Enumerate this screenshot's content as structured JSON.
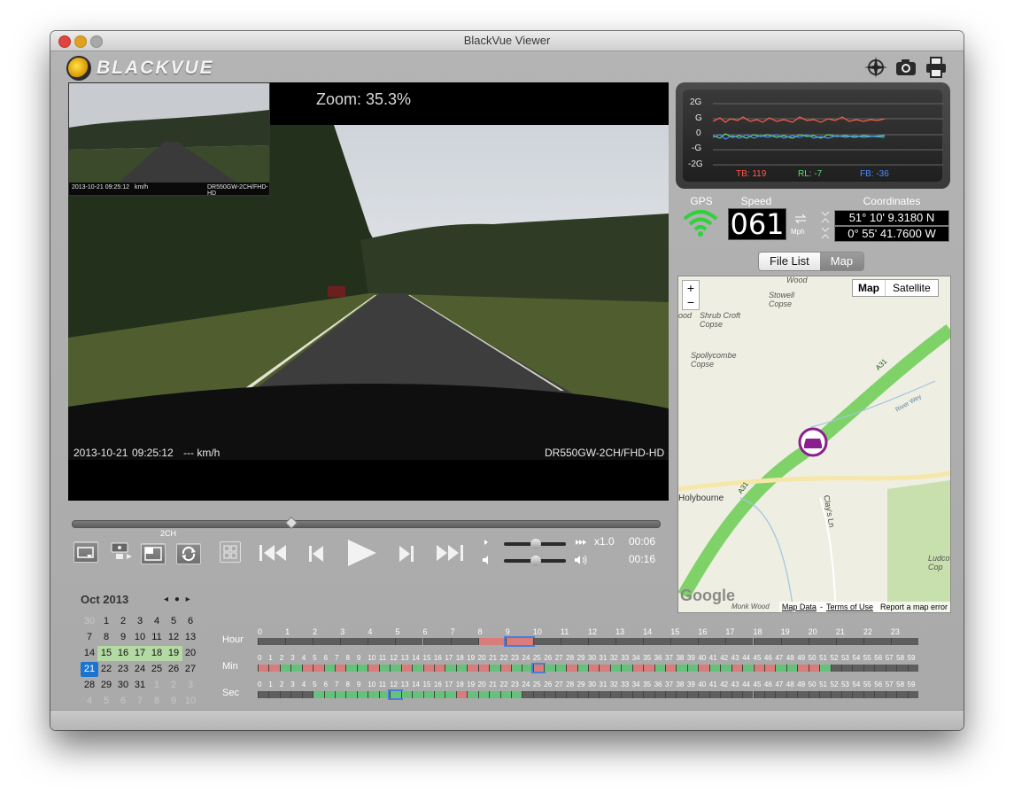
{
  "window": {
    "title": "BlackVue Viewer"
  },
  "brand": {
    "name": "BLACKVUE"
  },
  "video": {
    "zoom": "Zoom: 35.3%",
    "date": "2013-10-21",
    "time": "09:25:12",
    "speed": "--- km/h",
    "model": "DR550GW-2CH/FHD-HD",
    "pip_date": "2013-10-21 09:25:12",
    "pip_speed": "km/h",
    "pip_model": "DR550GW-2CH/FHD-HD"
  },
  "controls": {
    "channel_label": "2CH",
    "playback_speed": "x1.0",
    "time_current": "00:06",
    "time_total": "00:16"
  },
  "gsensor": {
    "ticks": [
      "2G",
      "G",
      "0",
      "-G",
      "-2G"
    ],
    "tb": "TB: 119",
    "rl": "RL: -7",
    "fb": "FB: -36",
    "colors": {
      "tb": "#ff5b4a",
      "rl": "#53e06a",
      "fb": "#4a8cff"
    }
  },
  "info": {
    "gps_label": "GPS",
    "speed_label": "Speed",
    "speed_value": "061",
    "speed_unit": "Mph",
    "coord_label": "Coordinates",
    "lat": "51° 10' 9.3180 N",
    "lon": "0° 55' 41.7600 W"
  },
  "tabs": {
    "file_list": "File List",
    "map": "Map"
  },
  "map": {
    "type_map": "Map",
    "type_satellite": "Satellite",
    "zoom_in": "+",
    "zoom_out": "−",
    "labels": [
      "Wood",
      "Stowell Copse",
      "ood",
      "Shrub Croft Copse",
      "Spollycombe Copse",
      "Holybourne",
      "Clay's Ln",
      "Ludco Cop",
      "A31",
      "A31",
      "River Wey",
      "Monk Wood"
    ],
    "google": "Google",
    "footer": {
      "data": "Map Data",
      "terms": "Terms of Use",
      "report": "Report a map error"
    }
  },
  "calendar": {
    "month": "Oct 2013",
    "days": [
      [
        "30",
        "1",
        "2",
        "3",
        "4",
        "5",
        "6"
      ],
      [
        "7",
        "8",
        "9",
        "10",
        "11",
        "12",
        "13"
      ],
      [
        "14",
        "15",
        "16",
        "17",
        "18",
        "19",
        "20"
      ],
      [
        "21",
        "22",
        "23",
        "24",
        "25",
        "26",
        "27"
      ],
      [
        "28",
        "29",
        "30",
        "31",
        "1",
        "2",
        "3"
      ],
      [
        "4",
        "5",
        "6",
        "7",
        "8",
        "9",
        "10"
      ]
    ],
    "highlight": [
      "15",
      "16",
      "17",
      "18",
      "19"
    ],
    "selected": "21"
  },
  "timeline": {
    "hour_label": "Hour",
    "min_label": "Min",
    "sec_label": "Sec",
    "hours": [
      "0",
      "1",
      "2",
      "3",
      "4",
      "5",
      "6",
      "7",
      "8",
      "9",
      "10",
      "11",
      "12",
      "13",
      "14",
      "15",
      "16",
      "17",
      "18",
      "19",
      "20",
      "21",
      "22",
      "23"
    ],
    "minutes": [
      "0",
      "1",
      "2",
      "3",
      "4",
      "5",
      "6",
      "7",
      "8",
      "9",
      "10",
      "11",
      "12",
      "13",
      "14",
      "15",
      "16",
      "17",
      "18",
      "19",
      "20",
      "21",
      "22",
      "23",
      "24",
      "25",
      "26",
      "27",
      "28",
      "29",
      "30",
      "31",
      "32",
      "33",
      "34",
      "35",
      "36",
      "37",
      "38",
      "39",
      "40",
      "41",
      "42",
      "43",
      "44",
      "45",
      "46",
      "47",
      "48",
      "49",
      "50",
      "51",
      "52",
      "53",
      "54",
      "55",
      "56",
      "57",
      "58",
      "59"
    ],
    "seconds": [
      "0",
      "1",
      "2",
      "3",
      "4",
      "5",
      "6",
      "7",
      "8",
      "9",
      "10",
      "11",
      "12",
      "13",
      "14",
      "15",
      "16",
      "17",
      "18",
      "19",
      "20",
      "21",
      "22",
      "23",
      "24",
      "25",
      "26",
      "27",
      "28",
      "29",
      "30",
      "31",
      "32",
      "33",
      "34",
      "35",
      "36",
      "37",
      "38",
      "39",
      "40",
      "41",
      "42",
      "43",
      "44",
      "45",
      "46",
      "47",
      "48",
      "49",
      "50",
      "51",
      "52",
      "53",
      "54",
      "55",
      "56",
      "57",
      "58",
      "59"
    ]
  }
}
